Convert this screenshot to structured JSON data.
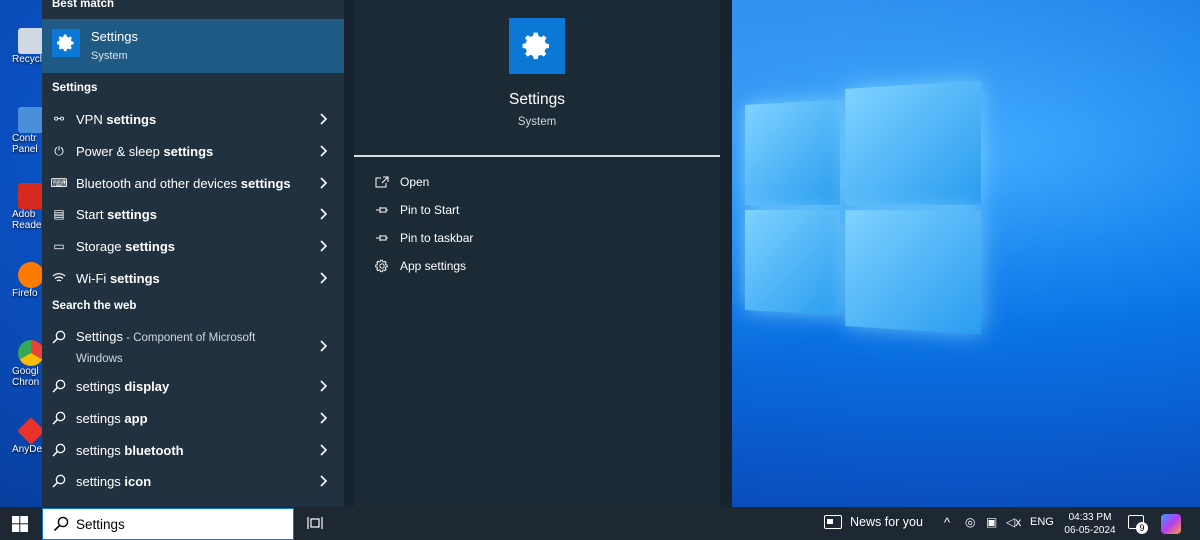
{
  "desktop": {
    "icons": [
      {
        "label": "Recycle",
        "color": "#cfd8e3"
      },
      {
        "label": "Contr Panel",
        "color": "#4a90d9"
      },
      {
        "label": "Adob Reade",
        "color": "#d62a1e"
      },
      {
        "label": "Firefo",
        "color": "#ff7b00"
      },
      {
        "label": "Googl Chron",
        "color": "#34a853"
      },
      {
        "label": "AnyDe",
        "color": "#e8322a"
      }
    ]
  },
  "start_left": {
    "best_match_header": "Best match",
    "best_match": {
      "title": "Settings",
      "subtitle": "System"
    },
    "settings_header": "Settings",
    "settings_items": [
      {
        "prefix": "VPN ",
        "bold": "settings",
        "icon": "vpn-icon"
      },
      {
        "prefix": "Power & sleep ",
        "bold": "settings",
        "icon": "power-icon"
      },
      {
        "prefix": "Bluetooth and other devices ",
        "bold": "settings",
        "icon": "devices-icon"
      },
      {
        "prefix": "Start ",
        "bold": "settings",
        "icon": "start-icon"
      },
      {
        "prefix": "Storage ",
        "bold": "settings",
        "icon": "storage-icon"
      },
      {
        "prefix": "Wi-Fi ",
        "bold": "settings",
        "icon": "wifi-icon"
      }
    ],
    "web_header": "Search the web",
    "web_items": [
      {
        "prefix": "Settings",
        "bold": "",
        "sub": " - Component of Microsoft",
        "line2": "Windows"
      },
      {
        "prefix": "settings ",
        "bold": "display"
      },
      {
        "prefix": "settings ",
        "bold": "app"
      },
      {
        "prefix": "settings ",
        "bold": "bluetooth"
      },
      {
        "prefix": "settings ",
        "bold": "icon"
      }
    ]
  },
  "detail": {
    "title": "Settings",
    "subtitle": "System",
    "actions": [
      {
        "label": "Open",
        "icon": "open-icon"
      },
      {
        "label": "Pin to Start",
        "icon": "pin-icon"
      },
      {
        "label": "Pin to taskbar",
        "icon": "pin-icon"
      },
      {
        "label": "App settings",
        "icon": "gear-icon"
      }
    ]
  },
  "taskbar": {
    "search_value": "Settings",
    "news": "News for you",
    "lang": "ENG",
    "time": "04:33 PM",
    "date": "06-05-2024",
    "notification_count": "9",
    "accent": "#0a78d4"
  }
}
